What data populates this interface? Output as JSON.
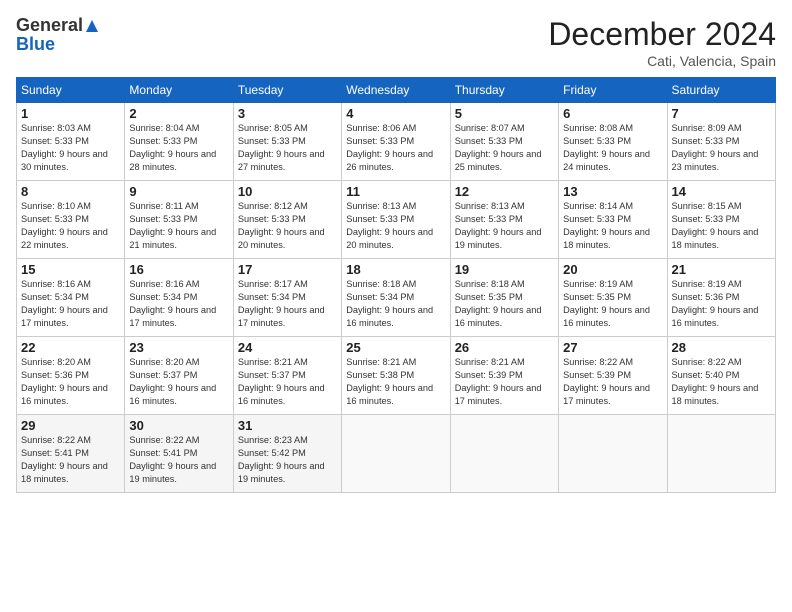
{
  "header": {
    "logo_general": "General",
    "logo_blue": "Blue",
    "month_title": "December 2024",
    "location": "Cati, Valencia, Spain"
  },
  "calendar": {
    "headers": [
      "Sunday",
      "Monday",
      "Tuesday",
      "Wednesday",
      "Thursday",
      "Friday",
      "Saturday"
    ],
    "weeks": [
      [
        {
          "day": "1",
          "sunrise": "8:03 AM",
          "sunset": "5:33 PM",
          "daylight": "9 hours and 30 minutes."
        },
        {
          "day": "2",
          "sunrise": "8:04 AM",
          "sunset": "5:33 PM",
          "daylight": "9 hours and 28 minutes."
        },
        {
          "day": "3",
          "sunrise": "8:05 AM",
          "sunset": "5:33 PM",
          "daylight": "9 hours and 27 minutes."
        },
        {
          "day": "4",
          "sunrise": "8:06 AM",
          "sunset": "5:33 PM",
          "daylight": "9 hours and 26 minutes."
        },
        {
          "day": "5",
          "sunrise": "8:07 AM",
          "sunset": "5:33 PM",
          "daylight": "9 hours and 25 minutes."
        },
        {
          "day": "6",
          "sunrise": "8:08 AM",
          "sunset": "5:33 PM",
          "daylight": "9 hours and 24 minutes."
        },
        {
          "day": "7",
          "sunrise": "8:09 AM",
          "sunset": "5:33 PM",
          "daylight": "9 hours and 23 minutes."
        }
      ],
      [
        {
          "day": "8",
          "sunrise": "8:10 AM",
          "sunset": "5:33 PM",
          "daylight": "9 hours and 22 minutes."
        },
        {
          "day": "9",
          "sunrise": "8:11 AM",
          "sunset": "5:33 PM",
          "daylight": "9 hours and 21 minutes."
        },
        {
          "day": "10",
          "sunrise": "8:12 AM",
          "sunset": "5:33 PM",
          "daylight": "9 hours and 20 minutes."
        },
        {
          "day": "11",
          "sunrise": "8:13 AM",
          "sunset": "5:33 PM",
          "daylight": "9 hours and 20 minutes."
        },
        {
          "day": "12",
          "sunrise": "8:13 AM",
          "sunset": "5:33 PM",
          "daylight": "9 hours and 19 minutes."
        },
        {
          "day": "13",
          "sunrise": "8:14 AM",
          "sunset": "5:33 PM",
          "daylight": "9 hours and 18 minutes."
        },
        {
          "day": "14",
          "sunrise": "8:15 AM",
          "sunset": "5:33 PM",
          "daylight": "9 hours and 18 minutes."
        }
      ],
      [
        {
          "day": "15",
          "sunrise": "8:16 AM",
          "sunset": "5:34 PM",
          "daylight": "9 hours and 17 minutes."
        },
        {
          "day": "16",
          "sunrise": "8:16 AM",
          "sunset": "5:34 PM",
          "daylight": "9 hours and 17 minutes."
        },
        {
          "day": "17",
          "sunrise": "8:17 AM",
          "sunset": "5:34 PM",
          "daylight": "9 hours and 17 minutes."
        },
        {
          "day": "18",
          "sunrise": "8:18 AM",
          "sunset": "5:34 PM",
          "daylight": "9 hours and 16 minutes."
        },
        {
          "day": "19",
          "sunrise": "8:18 AM",
          "sunset": "5:35 PM",
          "daylight": "9 hours and 16 minutes."
        },
        {
          "day": "20",
          "sunrise": "8:19 AM",
          "sunset": "5:35 PM",
          "daylight": "9 hours and 16 minutes."
        },
        {
          "day": "21",
          "sunrise": "8:19 AM",
          "sunset": "5:36 PM",
          "daylight": "9 hours and 16 minutes."
        }
      ],
      [
        {
          "day": "22",
          "sunrise": "8:20 AM",
          "sunset": "5:36 PM",
          "daylight": "9 hours and 16 minutes."
        },
        {
          "day": "23",
          "sunrise": "8:20 AM",
          "sunset": "5:37 PM",
          "daylight": "9 hours and 16 minutes."
        },
        {
          "day": "24",
          "sunrise": "8:21 AM",
          "sunset": "5:37 PM",
          "daylight": "9 hours and 16 minutes."
        },
        {
          "day": "25",
          "sunrise": "8:21 AM",
          "sunset": "5:38 PM",
          "daylight": "9 hours and 16 minutes."
        },
        {
          "day": "26",
          "sunrise": "8:21 AM",
          "sunset": "5:39 PM",
          "daylight": "9 hours and 17 minutes."
        },
        {
          "day": "27",
          "sunrise": "8:22 AM",
          "sunset": "5:39 PM",
          "daylight": "9 hours and 17 minutes."
        },
        {
          "day": "28",
          "sunrise": "8:22 AM",
          "sunset": "5:40 PM",
          "daylight": "9 hours and 18 minutes."
        }
      ],
      [
        {
          "day": "29",
          "sunrise": "8:22 AM",
          "sunset": "5:41 PM",
          "daylight": "9 hours and 18 minutes."
        },
        {
          "day": "30",
          "sunrise": "8:22 AM",
          "sunset": "5:41 PM",
          "daylight": "9 hours and 19 minutes."
        },
        {
          "day": "31",
          "sunrise": "8:23 AM",
          "sunset": "5:42 PM",
          "daylight": "9 hours and 19 minutes."
        },
        null,
        null,
        null,
        null
      ]
    ]
  }
}
